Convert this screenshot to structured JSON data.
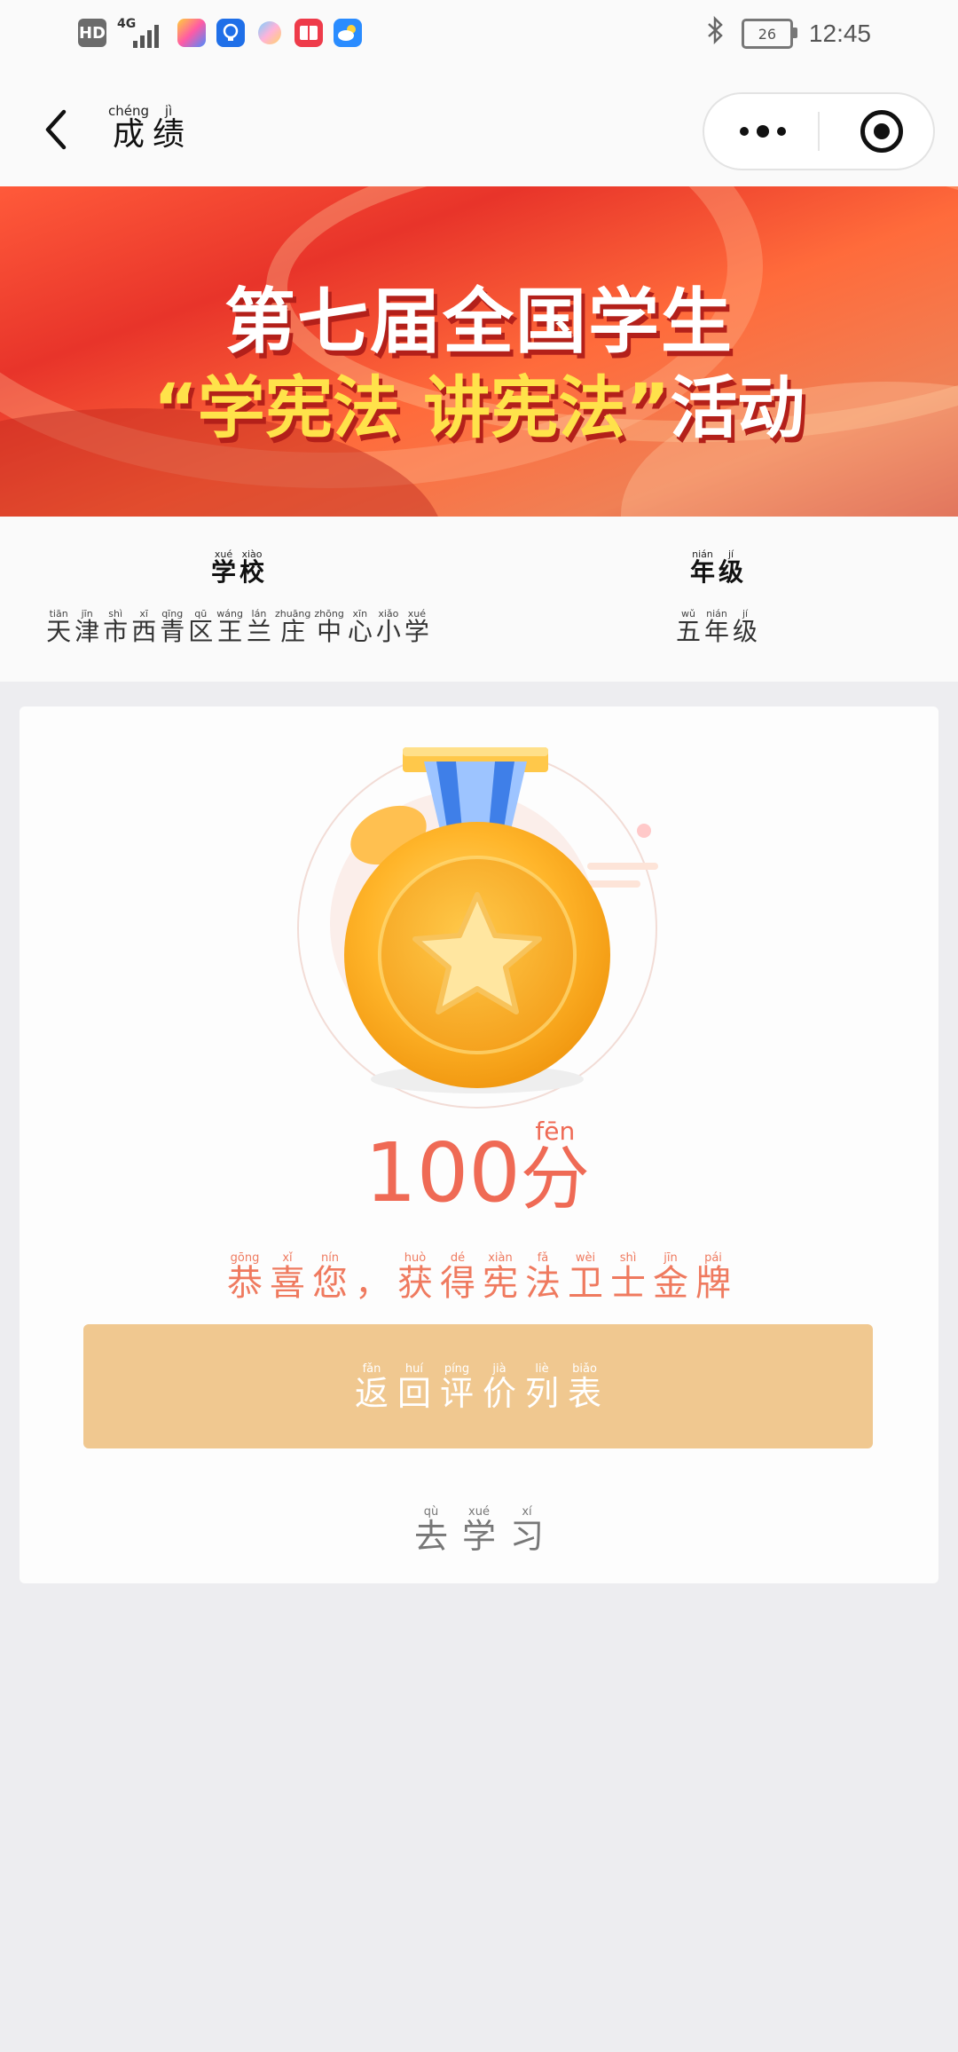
{
  "status_bar": {
    "hd": "HD",
    "network": "4G",
    "time": "12:45",
    "battery": "26",
    "icons": [
      "bluetooth-icon"
    ]
  },
  "nav": {
    "title": [
      {
        "hz": "成",
        "py": "chéng"
      },
      {
        "hz": "绩",
        "py": "jì"
      }
    ]
  },
  "banner": {
    "line1": "第七届全国学生",
    "line2_quote_open": "“",
    "line2_highlight": "学宪法 讲宪法",
    "line2_quote_close": "”",
    "line2_tail": "活动"
  },
  "info": {
    "school_label": [
      {
        "hz": "学",
        "py": "xué"
      },
      {
        "hz": "校",
        "py": "xiào"
      }
    ],
    "school_value": [
      {
        "hz": "天",
        "py": "tiān"
      },
      {
        "hz": "津",
        "py": "jīn"
      },
      {
        "hz": "市",
        "py": "shì"
      },
      {
        "hz": "西",
        "py": "xī"
      },
      {
        "hz": "青",
        "py": "qīng"
      },
      {
        "hz": "区",
        "py": "qū"
      },
      {
        "hz": "王",
        "py": "wáng"
      },
      {
        "hz": "兰",
        "py": "lán"
      },
      {
        "hz": "庄",
        "py": "zhuāng"
      },
      {
        "hz": "中",
        "py": "zhōng"
      },
      {
        "hz": "心",
        "py": "xīn"
      },
      {
        "hz": "小",
        "py": "xiǎo"
      },
      {
        "hz": "学",
        "py": "xué"
      }
    ],
    "grade_label": [
      {
        "hz": "年",
        "py": "nián"
      },
      {
        "hz": "级",
        "py": "jí"
      }
    ],
    "grade_value": [
      {
        "hz": "五",
        "py": "wǔ"
      },
      {
        "hz": "年",
        "py": "nián"
      },
      {
        "hz": "级",
        "py": "jí"
      }
    ]
  },
  "result": {
    "score_number": "100",
    "score_unit": {
      "hz": "分",
      "py": "fēn"
    },
    "congrats": [
      {
        "hz": "恭",
        "py": "gōng"
      },
      {
        "hz": "喜",
        "py": "xǐ"
      },
      {
        "hz": "您",
        "py": "nín"
      },
      {
        "hz": "，",
        "py": ""
      },
      {
        "hz": "获",
        "py": "huò"
      },
      {
        "hz": "得",
        "py": "dé"
      },
      {
        "hz": "宪",
        "py": "xiàn"
      },
      {
        "hz": "法",
        "py": "fǎ"
      },
      {
        "hz": "卫",
        "py": "wèi"
      },
      {
        "hz": "士",
        "py": "shì"
      },
      {
        "hz": "金",
        "py": "jīn"
      },
      {
        "hz": "牌",
        "py": "pái"
      }
    ],
    "return_button": [
      {
        "hz": "返",
        "py": "fǎn"
      },
      {
        "hz": "回",
        "py": "huí"
      },
      {
        "hz": "评",
        "py": "píng"
      },
      {
        "hz": "价",
        "py": "jià"
      },
      {
        "hz": "列",
        "py": "liè"
      },
      {
        "hz": "表",
        "py": "biǎo"
      }
    ],
    "study_link": [
      {
        "hz": "去",
        "py": "qù"
      },
      {
        "hz": "学",
        "py": "xué"
      },
      {
        "hz": "习",
        "py": "xí"
      }
    ]
  },
  "colors": {
    "accent": "#ef6a55",
    "button": "#f0c890",
    "background": "#ededf0"
  }
}
